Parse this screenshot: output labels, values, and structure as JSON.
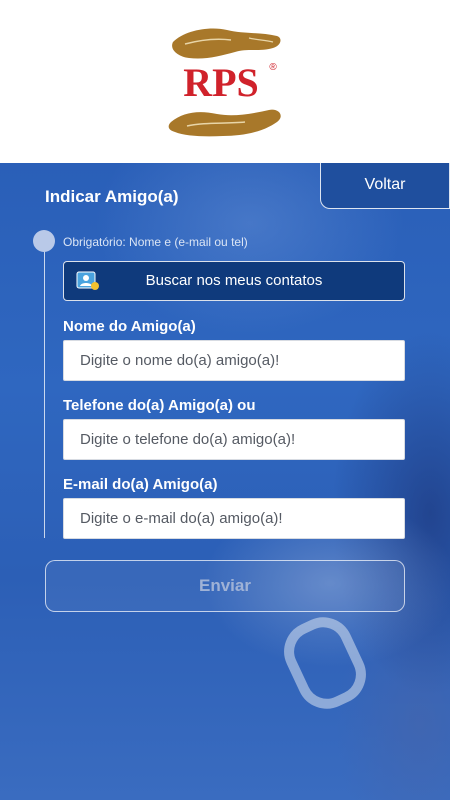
{
  "brand": {
    "logo_text": "RPS",
    "registered_mark": "®"
  },
  "header": {
    "back_label": "Voltar",
    "page_title": "Indicar Amigo(a)"
  },
  "form": {
    "required_note": "Obrigatório: Nome e (e-mail ou tel)",
    "contacts_button_label": "Buscar nos meus contatos",
    "name_label": "Nome do Amigo(a)",
    "name_placeholder": "Digite o nome do(a) amigo(a)!",
    "phone_label": "Telefone do(a) Amigo(a) ou",
    "phone_placeholder": "Digite o telefone do(a) amigo(a)!",
    "email_label": "E-mail do(a) Amigo(a)",
    "email_placeholder": "Digite o e-mail do(a) amigo(a)!",
    "submit_label": "Enviar"
  },
  "icons": {
    "logo": "rps-hands-logo",
    "contacts": "contacts-icon",
    "timeline": "timeline-dot"
  },
  "colors": {
    "brand_red": "#d0222b",
    "brand_gold": "#a8782a",
    "primary_blue": "#2a5fb8",
    "button_dark_blue": "#0f3a7c"
  }
}
